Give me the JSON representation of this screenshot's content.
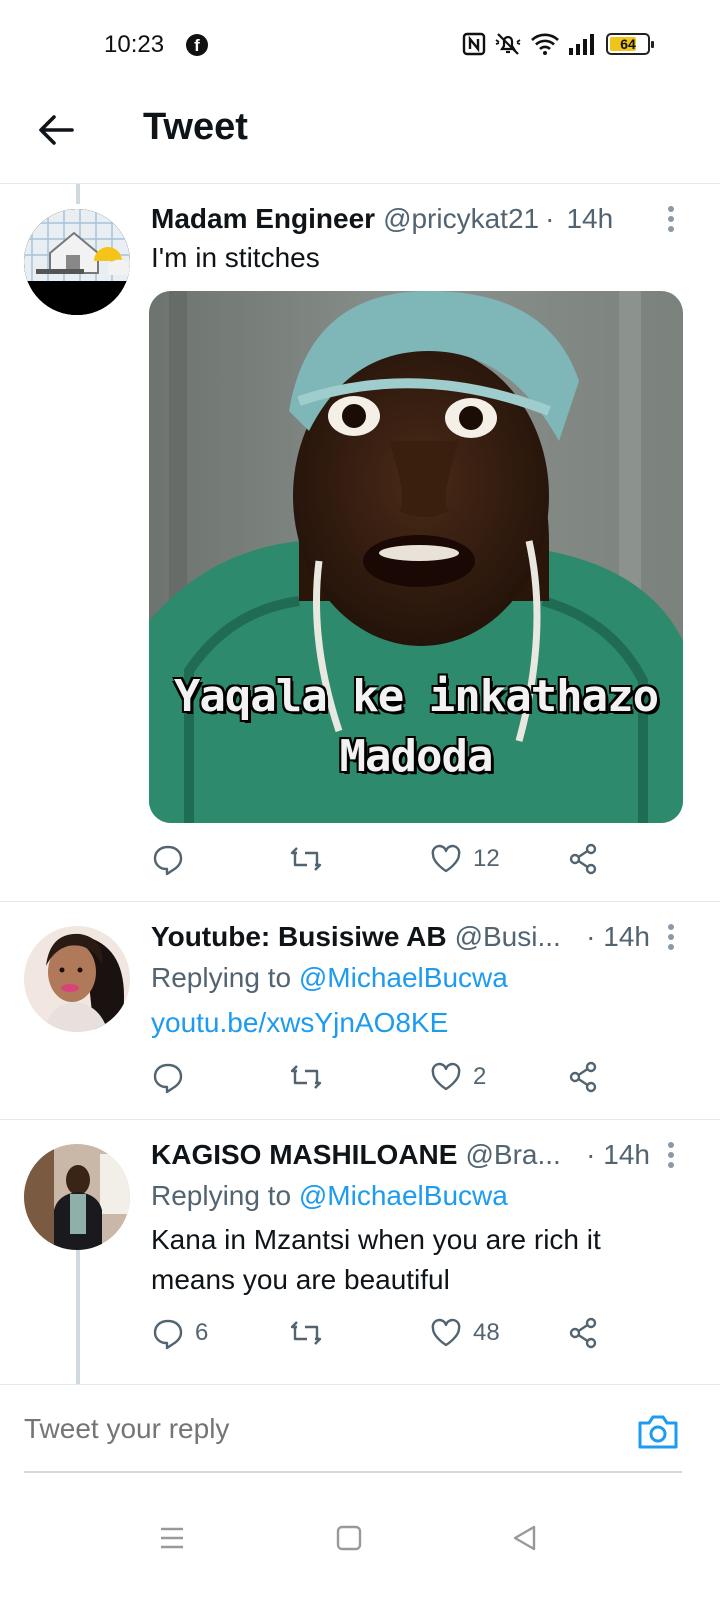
{
  "status_bar": {
    "time": "10:23",
    "notification_icon": "facebook-icon",
    "icons": [
      "nfc-icon",
      "mute-icon",
      "wifi-icon",
      "signal-icon"
    ],
    "battery_level": "64",
    "battery_color": "#f0c419"
  },
  "header": {
    "back_icon": "arrow-left-icon",
    "title": "Tweet"
  },
  "tweets": [
    {
      "display_name": "Madam Engineer",
      "handle": "@pricykat21",
      "separator": "·",
      "time": "14h",
      "text": "I'm in stitches",
      "media": {
        "caption_line1": "Yaqala ke inkathazo",
        "caption_line2": "Madoda"
      },
      "replies": "",
      "retweets": "",
      "likes": "12"
    },
    {
      "display_name": "Youtube: Busisiwe AB",
      "handle": "@Busi...",
      "separator": "·",
      "time": "14h",
      "replying_prefix": "Replying to",
      "replying_to": "@MichaelBucwa",
      "link": "youtu.be/xwsYjnAO8KE",
      "replies": "",
      "retweets": "",
      "likes": "2"
    },
    {
      "display_name": "KAGISO MASHILOANE",
      "handle": "@Bra...",
      "separator": "·",
      "time": "14h",
      "replying_prefix": "Replying to",
      "replying_to": "@MichaelBucwa",
      "text_line1": "Kana in Mzantsi when you are rich it",
      "text_line2": "means you are beautiful",
      "replies": "6",
      "retweets": "",
      "likes": "48"
    }
  ],
  "reply_bar": {
    "placeholder": "Tweet your reply",
    "camera_icon": "camera-icon"
  },
  "nav_bar": {
    "buttons": [
      "menu-icon",
      "home-square-icon",
      "back-triangle-icon"
    ]
  },
  "colors": {
    "accent": "#1d9bf0",
    "secondary_text": "#536471",
    "divider": "#e6e9ec",
    "thread_line": "#cfd9de"
  }
}
